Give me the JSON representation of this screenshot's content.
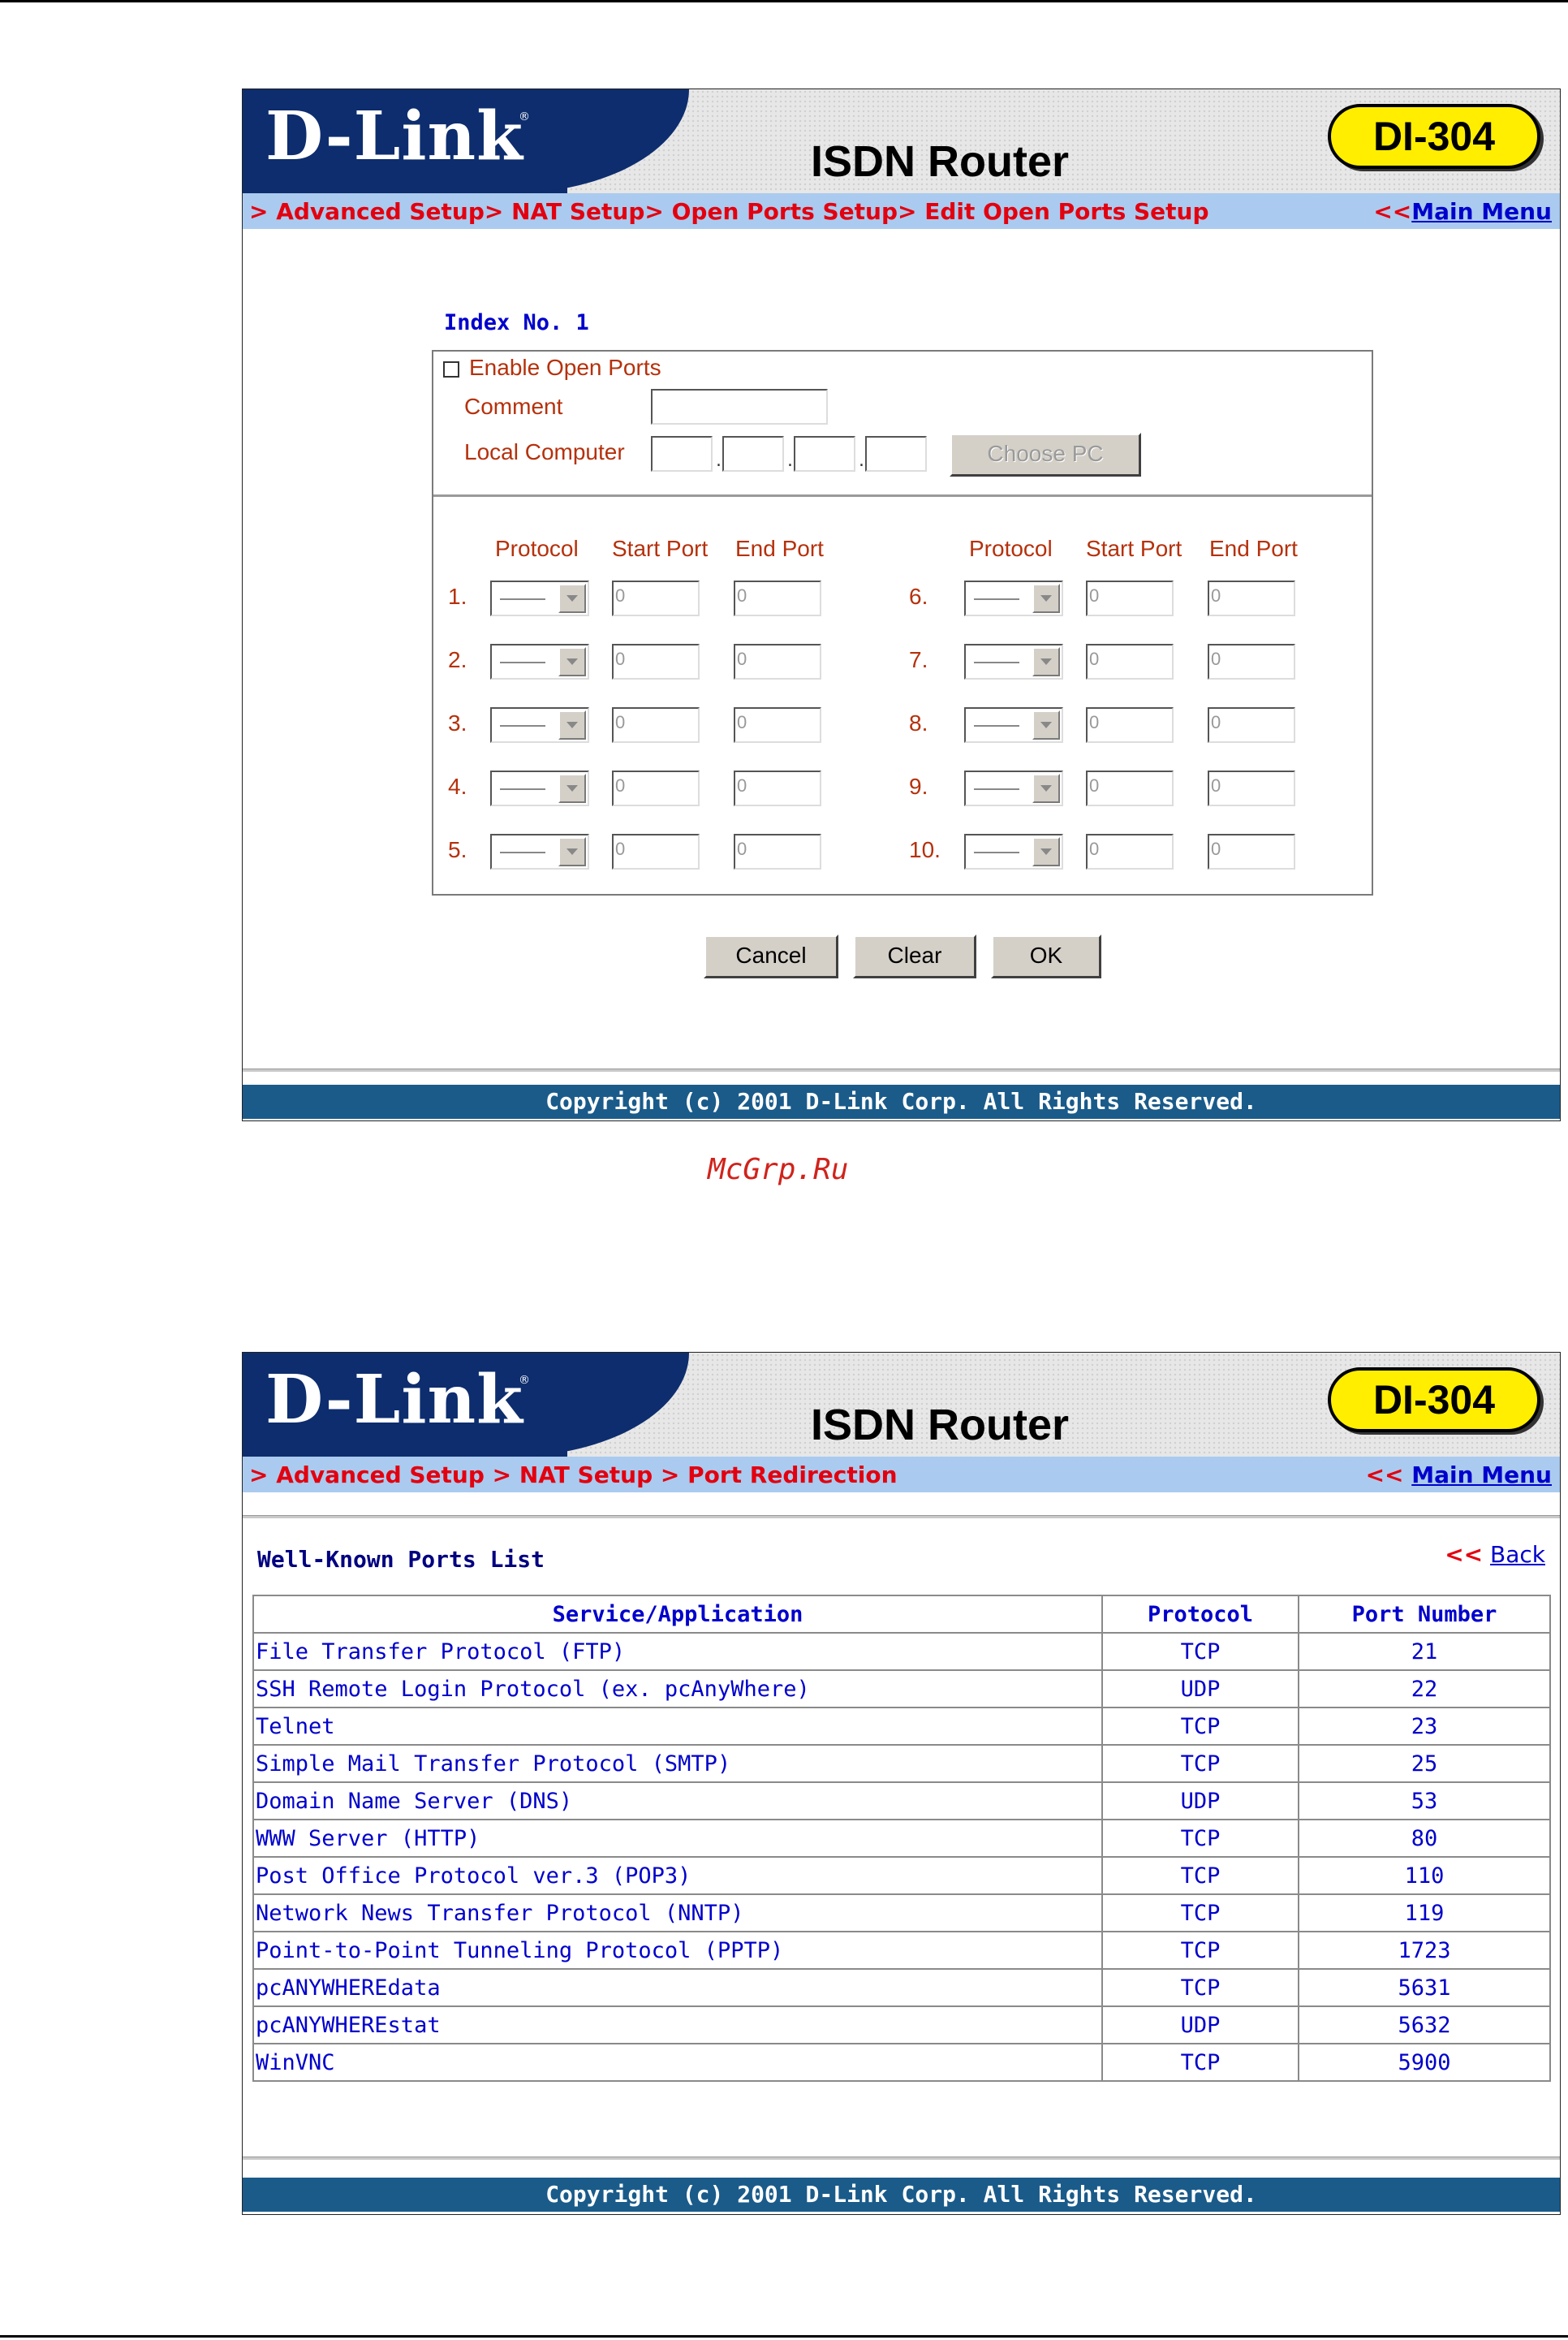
{
  "brand": {
    "logo": "D-Link",
    "reg": "®",
    "product": "ISDN Router",
    "model": "DI-304"
  },
  "screen1": {
    "breadcrumb": "> Advanced Setup> NAT Setup> Open Ports Setup> Edit Open Ports Setup",
    "main_menu_prefix": "<<",
    "main_menu_label": "Main Menu",
    "index_title": "Index No. 1",
    "enable_label": "Enable Open Ports",
    "comment_label": "Comment",
    "local_computer_label": "Local Computer",
    "choose_pc_label": "Choose PC",
    "headers": {
      "protocol": "Protocol",
      "start_port": "Start Port",
      "end_port": "End Port"
    },
    "rows": [
      {
        "num": "1.",
        "start": "0",
        "end": "0"
      },
      {
        "num": "2.",
        "start": "0",
        "end": "0"
      },
      {
        "num": "3.",
        "start": "0",
        "end": "0"
      },
      {
        "num": "4.",
        "start": "0",
        "end": "0"
      },
      {
        "num": "5.",
        "start": "0",
        "end": "0"
      },
      {
        "num": "6.",
        "start": "0",
        "end": "0"
      },
      {
        "num": "7.",
        "start": "0",
        "end": "0"
      },
      {
        "num": "8.",
        "start": "0",
        "end": "0"
      },
      {
        "num": "9.",
        "start": "0",
        "end": "0"
      },
      {
        "num": "10.",
        "start": "0",
        "end": "0"
      }
    ],
    "buttons": {
      "cancel": "Cancel",
      "clear": "Clear",
      "ok": "OK"
    },
    "footer": "Copyright (c) 2001 D-Link Corp. All Rights Reserved."
  },
  "watermark": "McGrp.Ru",
  "screen2": {
    "breadcrumb": "> Advanced Setup > NAT Setup > Port Redirection",
    "main_menu_prefix": "<<",
    "main_menu_label": "Main Menu",
    "title": "Well-Known Ports List",
    "back_prefix": "<<",
    "back_label": "Back",
    "columns": [
      "Service/Application",
      "Protocol",
      "Port Number"
    ],
    "ports": [
      [
        "File Transfer Protocol (FTP)",
        "TCP",
        "21"
      ],
      [
        "SSH Remote Login Protocol (ex. pcAnyWhere)",
        "UDP",
        "22"
      ],
      [
        "Telnet",
        "TCP",
        "23"
      ],
      [
        "Simple Mail Transfer Protocol (SMTP)",
        "TCP",
        "25"
      ],
      [
        "Domain Name Server (DNS)",
        "UDP",
        "53"
      ],
      [
        "WWW Server (HTTP)",
        "TCP",
        "80"
      ],
      [
        "Post Office Protocol ver.3 (POP3)",
        "TCP",
        "110"
      ],
      [
        "Network News Transfer Protocol (NNTP)",
        "TCP",
        "119"
      ],
      [
        "Point-to-Point Tunneling Protocol (PPTP)",
        "TCP",
        "1723"
      ],
      [
        "pcANYWHEREdata",
        "TCP",
        "5631"
      ],
      [
        "pcANYWHEREstat",
        "UDP",
        "5632"
      ],
      [
        "WinVNC",
        "TCP",
        "5900"
      ]
    ],
    "footer": "Copyright (c) 2001 D-Link Corp. All Rights Reserved."
  }
}
